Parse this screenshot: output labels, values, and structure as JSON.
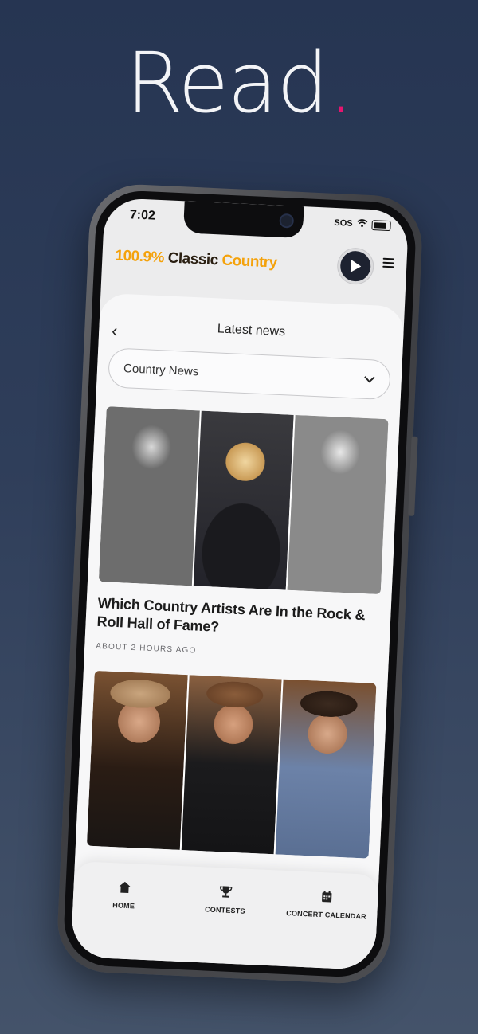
{
  "headline": {
    "word": "Read",
    "dot": "."
  },
  "status_bar": {
    "time": "7:02",
    "sos": "SOS"
  },
  "brand": {
    "part1": "100.9%",
    "part2": "Classic",
    "part3": "Country"
  },
  "colors": {
    "accent_orange": "#f4a20c",
    "dot_pink": "#e6156f",
    "background": "#263552"
  },
  "header": {
    "title": "Latest news"
  },
  "category": {
    "selected": "Country News"
  },
  "articles": [
    {
      "title": "Which Country Artists Are In the Rock & Roll Hall of Fame?",
      "meta": "ABOUT 2 HOURS AGO"
    }
  ],
  "tabs": [
    {
      "label": "HOME",
      "icon": "home-icon"
    },
    {
      "label": "CONTESTS",
      "icon": "trophy-icon"
    },
    {
      "label": "CONCERT CALENDAR",
      "icon": "calendar-icon"
    }
  ]
}
